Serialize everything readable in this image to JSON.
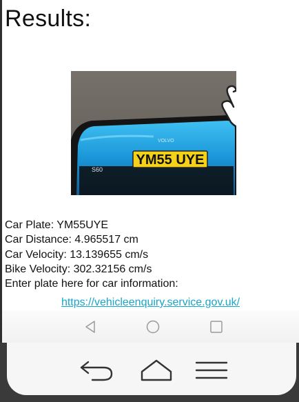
{
  "page": {
    "title": "Results:"
  },
  "photo": {
    "plate_text": "YM55 UYE",
    "brand_badge": "VOLVO",
    "model_badge": "S60"
  },
  "results": {
    "car_plate": "Car Plate: YM55UYE",
    "car_distance": "Car Distance: 4.965517 cm",
    "car_velocity": "Car Velocity: 13.139655 cm/s",
    "bike_velocity": "Bike Velocity: 302.32156 cm/s",
    "enter_plate_prompt": "Enter plate here for car information:"
  },
  "link": {
    "text": "https://vehicleenquiry.service.gov.uk/"
  },
  "navigation": {
    "soft_buttons": [
      "back-triangle-icon",
      "home-circle-icon",
      "recents-square-icon"
    ],
    "hardware_keys": [
      "back-arrow-icon",
      "home-house-icon",
      "menu-lines-icon"
    ]
  },
  "colors": {
    "link": "#17a6c8",
    "car_body": "#1aa0e0",
    "plate": "#f5d21a"
  }
}
